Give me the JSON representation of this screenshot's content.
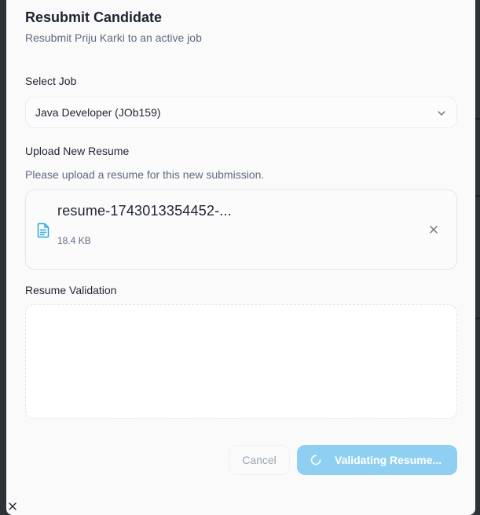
{
  "dialog": {
    "title": "Resubmit Candidate",
    "subtitle": "Resubmit Priju Karki to an active job"
  },
  "job_select": {
    "label": "Select Job",
    "value": "Java Developer (JOb159)",
    "icon": "chevron-down-icon"
  },
  "upload": {
    "label": "Upload New Resume",
    "helper": "Please upload a resume for this new submission.",
    "file": {
      "name": "resume-1743013354452-...",
      "size": "18.4 KB",
      "icon": "file-text-icon",
      "remove_icon": "close-icon"
    }
  },
  "validation": {
    "label": "Resume Validation"
  },
  "actions": {
    "cancel_label": "Cancel",
    "submit_label": "Validating Resume...",
    "submit_icon": "spinner-icon"
  },
  "colors": {
    "accent": "#8fd0f2",
    "file_icon": "#29a9e0",
    "text_primary": "#1f2433",
    "text_muted": "#5e6b80"
  }
}
